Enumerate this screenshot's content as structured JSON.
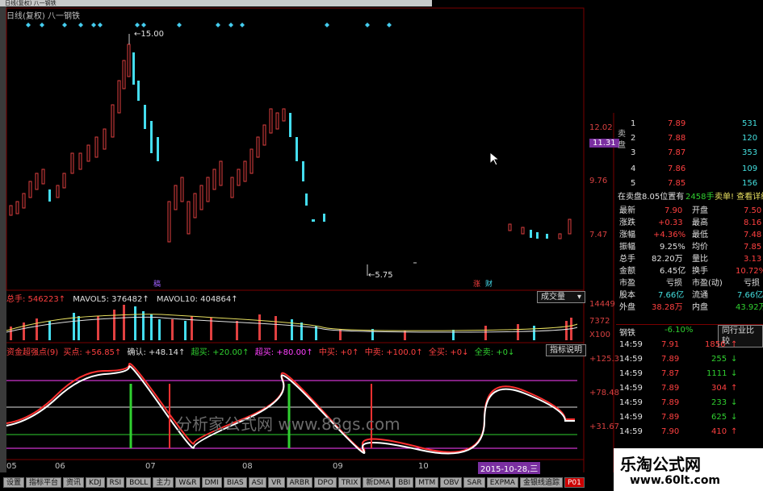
{
  "top_menu": "日线(复权)  八一钢铁",
  "chart_title": "日线(复权)  八一钢铁",
  "price_axis": {
    "v1": "12.02",
    "v2": "11.31",
    "v3": "9.76",
    "v4": "7.47"
  },
  "price_notes": {
    "high": "←15.00",
    "low": "←5.75"
  },
  "markers": {
    "m1": "稿",
    "m2": "涨",
    "m3": "财"
  },
  "volume_header": {
    "total": "总手: 546223↑",
    "mavol5": "MAVOL5: 376482↑",
    "mavol10": "MAVOL10: 404864↑",
    "dropdown": "成交量"
  },
  "volume_axis": {
    "v1": "14449",
    "v2": "7372",
    "v3": "X100"
  },
  "indicator_header": {
    "name": "资金超强点(9)",
    "buy": "买点: +56.85↑",
    "confirm": "确认: +48.14↑",
    "super": "超买: +20.00↑",
    "ultra": "超买: +80.00↑",
    "mid_buy": "中买: +0↑",
    "mid_sell": "中卖: +100.0↑",
    "all_buy": "全买: +0↓",
    "all_sell": "全卖: +0↓",
    "button": "指标说明"
  },
  "indicator_axis": {
    "v1": "+125.3",
    "v2": "+78.48",
    "v3": "+31.67"
  },
  "watermark_chart": "分析家公式网 www.88gs.com",
  "x_axis": [
    "05",
    "06",
    "07",
    "08",
    "09",
    "10"
  ],
  "date_badge": "2015-10-28,三",
  "tabs": [
    "设置",
    "指标平台",
    "资讯",
    "KDJ",
    "RSI",
    "BOLL",
    "主力",
    "W&R",
    "DMI",
    "BIAS",
    "ASI",
    "VR",
    "ARBR",
    "DPO",
    "TRIX",
    "新DMA",
    "BBI",
    "MTM",
    "OBV",
    "SAR",
    "EXPMA",
    "金银线追踪",
    "P01"
  ],
  "order_book": {
    "side_label": "卖盘",
    "rows": [
      {
        "lvl": "1",
        "price": "7.89",
        "vol": "531"
      },
      {
        "lvl": "2",
        "price": "7.88",
        "vol": "120"
      },
      {
        "lvl": "3",
        "price": "7.87",
        "vol": "353"
      },
      {
        "lvl": "4",
        "price": "7.86",
        "vol": "109"
      },
      {
        "lvl": "5",
        "price": "7.85",
        "vol": "156"
      }
    ],
    "summary": "在卖盘8.05位置有",
    "summary_qty": "2458手",
    "summary_action": "卖单! 查看详细"
  },
  "quote": [
    {
      "l1": "最新",
      "v1": "7.90",
      "l2": "开盘",
      "v2": "7.50"
    },
    {
      "l1": "涨跌",
      "v1": "+0.33",
      "l2": "最高",
      "v2": "8.16"
    },
    {
      "l1": "涨幅",
      "v1": "+4.36%",
      "l2": "最低",
      "v2": "7.48"
    },
    {
      "l1": "振幅",
      "v1": "9.25%",
      "l2": "均价",
      "v2": "7.85"
    },
    {
      "l1": "总手",
      "v1": "82.20万",
      "l2": "量比",
      "v2": "3.13"
    },
    {
      "l1": "金额",
      "v1": "6.45亿",
      "l2": "换手",
      "v2": "10.72%"
    },
    {
      "l1": "市盈",
      "v1": "亏损",
      "l2": "市盈(动)",
      "v2": "亏损"
    },
    {
      "l1": "股本",
      "v1": "7.66亿",
      "l2": "流通",
      "v2": "7.66亿"
    },
    {
      "l1": "外盘",
      "v1": "38.28万",
      "l2": "内盘",
      "v2": "43.92万"
    }
  ],
  "industry": {
    "name": "钢铁",
    "change": "-6.10%",
    "button": "同行业比较"
  },
  "ticks": [
    {
      "t": "14:59",
      "p": "7.91",
      "v": "1856",
      "d": "up"
    },
    {
      "t": "14:59",
      "p": "7.89",
      "v": "255",
      "d": "down"
    },
    {
      "t": "14:59",
      "p": "7.87",
      "v": "1111",
      "d": "down"
    },
    {
      "t": "14:59",
      "p": "7.89",
      "v": "304",
      "d": "up"
    },
    {
      "t": "14:59",
      "p": "7.89",
      "v": "233",
      "d": "down"
    },
    {
      "t": "14:59",
      "p": "7.89",
      "v": "625",
      "d": "down"
    },
    {
      "t": "14:59",
      "p": "7.90",
      "v": "410",
      "d": "up"
    }
  ],
  "brand_watermark": {
    "line1": "乐淘公式网",
    "line2": "www.60lt.com"
  }
}
